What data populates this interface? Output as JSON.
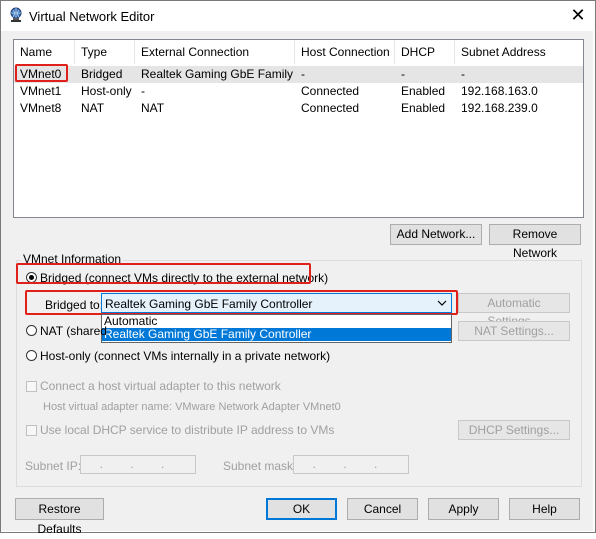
{
  "window": {
    "title": "Virtual Network Editor",
    "close_symbol": "✕"
  },
  "table": {
    "headers": [
      "Name",
      "Type",
      "External Connection",
      "Host Connection",
      "DHCP",
      "Subnet Address"
    ],
    "rows": [
      [
        "VMnet0",
        "Bridged",
        "Realtek Gaming GbE Family ...",
        "-",
        "-",
        "-"
      ],
      [
        "VMnet1",
        "Host-only",
        "-",
        "Connected",
        "Enabled",
        "192.168.163.0"
      ],
      [
        "VMnet8",
        "NAT",
        "NAT",
        "Connected",
        "Enabled",
        "192.168.239.0"
      ]
    ]
  },
  "buttons": {
    "add_network": "Add Network...",
    "remove_network": "Remove Network",
    "automatic_settings": "Automatic Settings...",
    "nat_settings": "NAT Settings...",
    "dhcp_settings": "DHCP Settings...",
    "restore_defaults": "Restore Defaults",
    "ok": "OK",
    "cancel": "Cancel",
    "apply": "Apply",
    "help": "Help"
  },
  "vmnet_info": {
    "group_title": "VMnet Information",
    "bridged_label": "Bridged (connect VMs directly to the external network)",
    "bridged_to_label": "Bridged to:",
    "bridged_to_value": "Realtek Gaming GbE Family Controller",
    "dropdown_options": [
      "Automatic",
      "Realtek Gaming GbE Family Controller"
    ],
    "nat_label": "NAT (shared",
    "host_only_label": "Host-only (connect VMs internally in a private network)",
    "connect_adapter_label": "Connect a host virtual adapter to this network",
    "adapter_name_label": "Host virtual adapter name: VMware Network Adapter VMnet0",
    "use_dhcp_label": "Use local DHCP service to distribute IP address to VMs",
    "subnet_ip_label": "Subnet IP:",
    "subnet_mask_label": "Subnet mask:",
    "ip_dots": ". . ."
  },
  "colors": {
    "highlight": "#e0201b",
    "accent": "#0078d7"
  }
}
